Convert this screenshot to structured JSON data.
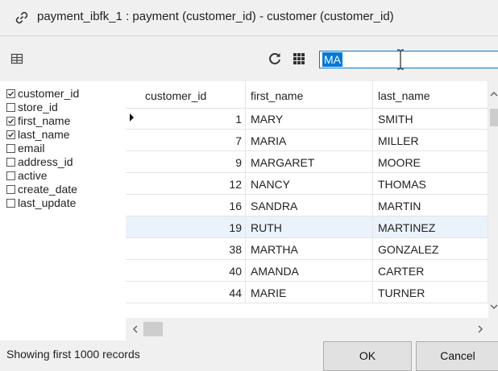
{
  "window": {
    "title": "payment_ibfk_1 : payment (customer_id) - customer (customer_id)"
  },
  "toolbar": {
    "left_icon": "grid-layout-icon",
    "refresh_icon": "refresh-icon",
    "grid_icon": "grid-icon",
    "search": {
      "value": "MA"
    }
  },
  "columns_panel": {
    "items": [
      {
        "label": "customer_id",
        "checked": true
      },
      {
        "label": "store_id",
        "checked": false
      },
      {
        "label": "first_name",
        "checked": true
      },
      {
        "label": "last_name",
        "checked": true
      },
      {
        "label": "email",
        "checked": false
      },
      {
        "label": "address_id",
        "checked": false
      },
      {
        "label": "active",
        "checked": false
      },
      {
        "label": "create_date",
        "checked": false
      },
      {
        "label": "last_update",
        "checked": false
      }
    ]
  },
  "grid": {
    "columns": [
      "customer_id",
      "first_name",
      "last_name"
    ],
    "rows": [
      {
        "customer_id": "1",
        "first_name": "MARY",
        "last_name": "SMITH",
        "current": true,
        "selected": false
      },
      {
        "customer_id": "7",
        "first_name": "MARIA",
        "last_name": "MILLER",
        "current": false,
        "selected": false
      },
      {
        "customer_id": "9",
        "first_name": "MARGARET",
        "last_name": "MOORE",
        "current": false,
        "selected": false
      },
      {
        "customer_id": "12",
        "first_name": "NANCY",
        "last_name": "THOMAS",
        "current": false,
        "selected": false
      },
      {
        "customer_id": "16",
        "first_name": "SANDRA",
        "last_name": "MARTIN",
        "current": false,
        "selected": false
      },
      {
        "customer_id": "19",
        "first_name": "RUTH",
        "last_name": "MARTINEZ",
        "current": false,
        "selected": true
      },
      {
        "customer_id": "38",
        "first_name": "MARTHA",
        "last_name": "GONZALEZ",
        "current": false,
        "selected": false
      },
      {
        "customer_id": "40",
        "first_name": "AMANDA",
        "last_name": "CARTER",
        "current": false,
        "selected": false
      },
      {
        "customer_id": "44",
        "first_name": "MARIE",
        "last_name": "TURNER",
        "current": false,
        "selected": false
      }
    ]
  },
  "status": {
    "text": "Showing first 1000 records"
  },
  "buttons": {
    "ok": "OK",
    "cancel": "Cancel"
  },
  "colors": {
    "accent": "#0078d7",
    "selected_row": "#eaf2fb"
  }
}
